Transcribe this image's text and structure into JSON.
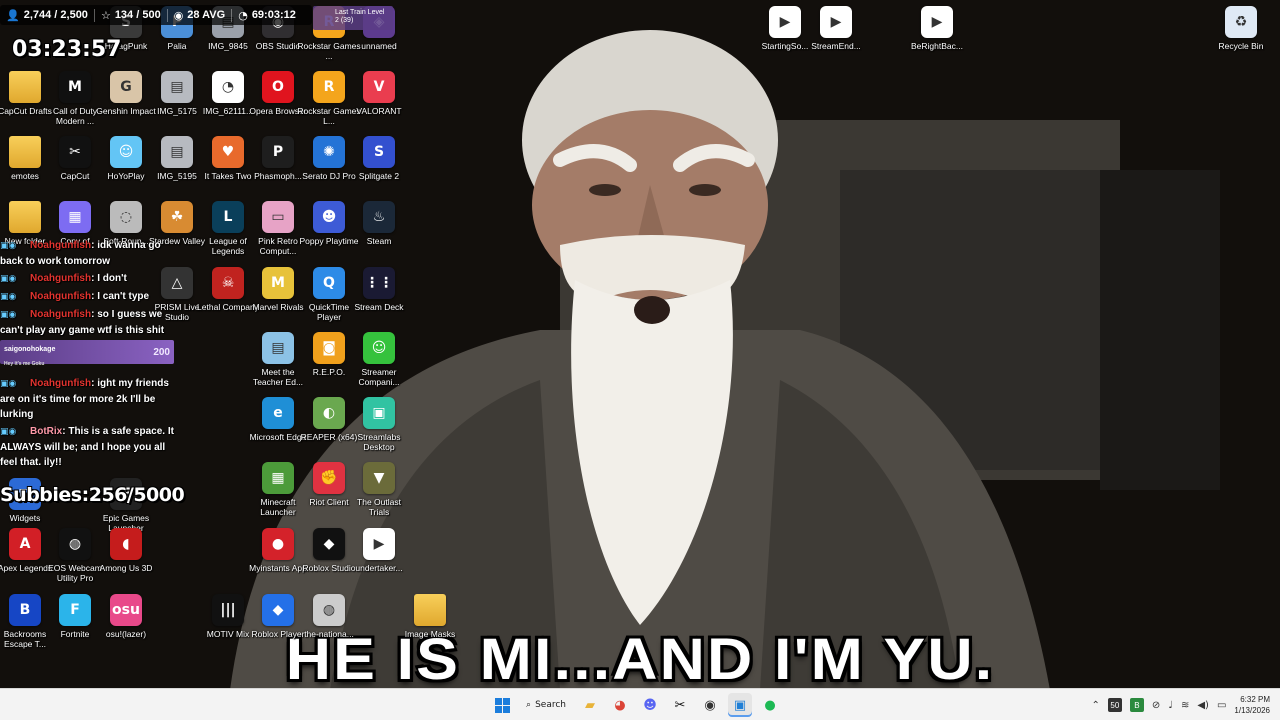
{
  "wallpaper": {
    "caption": "HE IS MI...AND I'M YU."
  },
  "overlay": {
    "followers": "2,744 / 2,500",
    "stars": "134 / 500",
    "viewers": "28 AVG",
    "timer": "69:03:12",
    "uptime": "03:23:57",
    "subs": "Subbies:256/5000",
    "redeem": {
      "user": "saigonohokage",
      "text": "Hey it's me Goku",
      "cost": "200"
    },
    "chat": [
      {
        "user": "Noahgunfish",
        "text": ": idk wanna go back to work tomorrow",
        "bot": false
      },
      {
        "user": "Noahgunfish",
        "text": ": I don't",
        "bot": false
      },
      {
        "user": "Noahgunfish",
        "text": ": I can't type",
        "bot": false
      },
      {
        "user": "Noahgunfish",
        "text": ": so I guess we can't play any game wtf is this shit",
        "bot": false
      },
      {
        "user": "Noahgunfish",
        "text": ": ight my friends are on it's time for more 2k I'll be lurking",
        "bot": false
      },
      {
        "user": "BotRix",
        "text": ": This is a safe space. It ALWAYS will be; and I hope you all feel that. ily!!",
        "bot": true
      }
    ]
  },
  "desktop": {
    "icons": [
      {
        "label": "HaragPunk",
        "color": "#3a3a3a",
        "glyph": "S",
        "kind": "app"
      },
      {
        "label": "Palia",
        "color": "#4b8fd8",
        "glyph": "P",
        "kind": "app"
      },
      {
        "label": "IMG_9845",
        "color": "#9aa0aa",
        "glyph": "▤",
        "kind": "app"
      },
      {
        "label": "OBS Studio",
        "color": "#302e31",
        "glyph": "◉",
        "kind": "app"
      },
      {
        "label": "Rockstar Games ...",
        "color": "#f4a51c",
        "glyph": "R",
        "kind": "app"
      },
      {
        "label": "unnamed",
        "color": "#5d3b8f",
        "glyph": "◈",
        "kind": "app"
      },
      {
        "label": "CapCut Drafts",
        "color": "",
        "glyph": "",
        "kind": "folder"
      },
      {
        "label": "Call of Duty Modern ...",
        "color": "#101010",
        "glyph": "M",
        "kind": "app"
      },
      {
        "label": "Genshin Impact",
        "color": "#d9c5a8",
        "glyph": "G",
        "kind": "app"
      },
      {
        "label": "IMG_5175",
        "color": "#b7bac0",
        "glyph": "▤",
        "kind": "app"
      },
      {
        "label": "IMG_62111...",
        "color": "#ffffff",
        "glyph": "◔",
        "kind": "app"
      },
      {
        "label": "Opera Browser",
        "color": "#e0141e",
        "glyph": "O",
        "kind": "app"
      },
      {
        "label": "Rockstar Games L...",
        "color": "#f4a51c",
        "glyph": "R",
        "kind": "app"
      },
      {
        "label": "VALORANT",
        "color": "#ea3d4f",
        "glyph": "V",
        "kind": "app"
      },
      {
        "label": "emotes",
        "color": "",
        "glyph": "",
        "kind": "folder"
      },
      {
        "label": "CapCut",
        "color": "#111111",
        "glyph": "✂",
        "kind": "app"
      },
      {
        "label": "HoYoPlay",
        "color": "#63c5f5",
        "glyph": "☺",
        "kind": "app"
      },
      {
        "label": "IMG_5195",
        "color": "#b7bac0",
        "glyph": "▤",
        "kind": "app"
      },
      {
        "label": "It Takes Two",
        "color": "#e86a2c",
        "glyph": "♥",
        "kind": "app"
      },
      {
        "label": "Phasmoph...",
        "color": "#1e1e1e",
        "glyph": "P",
        "kind": "app"
      },
      {
        "label": "Serato DJ Pro",
        "color": "#2473d6",
        "glyph": "✺",
        "kind": "app"
      },
      {
        "label": "Splitgate 2",
        "color": "#3350cf",
        "glyph": "S",
        "kind": "app"
      },
      {
        "label": "New folder",
        "color": "",
        "glyph": "",
        "kind": "folder"
      },
      {
        "label": "Copy of",
        "color": "#7d6cf2",
        "glyph": "▦",
        "kind": "app"
      },
      {
        "label": "Soft-Roun...",
        "color": "#bbb",
        "glyph": "◌",
        "kind": "app"
      },
      {
        "label": "Stardew Valley",
        "color": "#d88b32",
        "glyph": "☘",
        "kind": "app"
      },
      {
        "label": "League of Legends",
        "color": "#0a3f5a",
        "glyph": "L",
        "kind": "app"
      },
      {
        "label": "Pink Retro Comput...",
        "color": "#e7a3c6",
        "glyph": "▭",
        "kind": "app"
      },
      {
        "label": "Poppy Playtime",
        "color": "#3d5bd6",
        "glyph": "☻",
        "kind": "app"
      },
      {
        "label": "Steam",
        "color": "#1b2838",
        "glyph": "♨",
        "kind": "app"
      },
      {
        "label": "PRISM Live Studio",
        "color": "#333",
        "glyph": "△",
        "kind": "app"
      },
      {
        "label": "Lethal Company",
        "color": "#c0231f",
        "glyph": "☠",
        "kind": "app"
      },
      {
        "label": "Marvel Rivals",
        "color": "#e7c23a",
        "glyph": "M",
        "kind": "app"
      },
      {
        "label": "QuickTime Player",
        "color": "#2d8be7",
        "glyph": "Q",
        "kind": "app"
      },
      {
        "label": "Stream Deck",
        "color": "#1a1a33",
        "glyph": "⋮⋮",
        "kind": "app"
      },
      {
        "label": "Meet the Teacher Ed...",
        "color": "#8cc2e6",
        "glyph": "▤",
        "kind": "app"
      },
      {
        "label": "R.E.P.O.",
        "color": "#f0a01c",
        "glyph": "◙",
        "kind": "app"
      },
      {
        "label": "Streamer Compani...",
        "color": "#35c23d",
        "glyph": "☺",
        "kind": "app"
      },
      {
        "label": "Microsoft Edge",
        "color": "#1f8fd6",
        "glyph": "e",
        "kind": "app"
      },
      {
        "label": "REAPER (x64)",
        "color": "#6aa84f",
        "glyph": "◐",
        "kind": "app"
      },
      {
        "label": "Streamlabs Desktop",
        "color": "#31c3a2",
        "glyph": "▣",
        "kind": "app"
      },
      {
        "label": "Minecraft Launcher",
        "color": "#4c9b3a",
        "glyph": "▦",
        "kind": "app"
      },
      {
        "label": "Riot Client",
        "color": "#e03241",
        "glyph": "✊",
        "kind": "app"
      },
      {
        "label": "The Outlast Trials",
        "color": "#6b6b3a",
        "glyph": "▼",
        "kind": "app"
      },
      {
        "label": "Widgets",
        "color": "#2c6ad6",
        "glyph": "◫",
        "kind": "app"
      },
      {
        "label": "Epic Games Launcher",
        "color": "#222",
        "glyph": "E",
        "kind": "app"
      },
      {
        "label": "Apex Legends",
        "color": "#d21f26",
        "glyph": "A",
        "kind": "app"
      },
      {
        "label": "EOS Webcam Utility Pro",
        "color": "#111",
        "glyph": "◍",
        "kind": "app"
      },
      {
        "label": "Among Us 3D",
        "color": "#c51c1c",
        "glyph": "◖",
        "kind": "app"
      },
      {
        "label": "Myinstants App",
        "color": "#d4222a",
        "glyph": "●",
        "kind": "app"
      },
      {
        "label": "Roblox Studio",
        "color": "#111",
        "glyph": "◆",
        "kind": "app"
      },
      {
        "label": "undertaker...",
        "color": "#fff",
        "glyph": "▶",
        "kind": "app"
      },
      {
        "label": "Backrooms Escape T...",
        "color": "#1646c5",
        "glyph": "B",
        "kind": "app"
      },
      {
        "label": "Fortnite",
        "color": "#2bb4ea",
        "glyph": "F",
        "kind": "app"
      },
      {
        "label": "osu!(lazer)",
        "color": "#e8498a",
        "glyph": "osu",
        "kind": "app"
      },
      {
        "label": "MOTIV Mix",
        "color": "#111",
        "glyph": "|||",
        "kind": "app"
      },
      {
        "label": "Roblox Player",
        "color": "#2470e8",
        "glyph": "◆",
        "kind": "app"
      },
      {
        "label": "the-nationa...",
        "color": "#ccc",
        "glyph": "◍",
        "kind": "app"
      },
      {
        "label": "Image Masks",
        "color": "",
        "glyph": "",
        "kind": "folder"
      },
      {
        "label": "StartingSo...",
        "color": "#fff",
        "glyph": "▶",
        "kind": "app"
      },
      {
        "label": "StreamEnd...",
        "color": "#fff",
        "glyph": "▶",
        "kind": "app"
      },
      {
        "label": "BeRightBac...",
        "color": "#fff",
        "glyph": "▶",
        "kind": "app"
      },
      {
        "label": "Recycle Bin",
        "color": "#dfe9f5",
        "glyph": "♻",
        "kind": "app"
      },
      {
        "label": "Last Train Level 2 (39)",
        "color": "#5a3d86",
        "glyph": "▶",
        "kind": "app"
      }
    ]
  },
  "taskbar": {
    "search_label": "Search",
    "time": "6:32 PM",
    "date": "1/13/2026",
    "tray_counter": "50"
  }
}
